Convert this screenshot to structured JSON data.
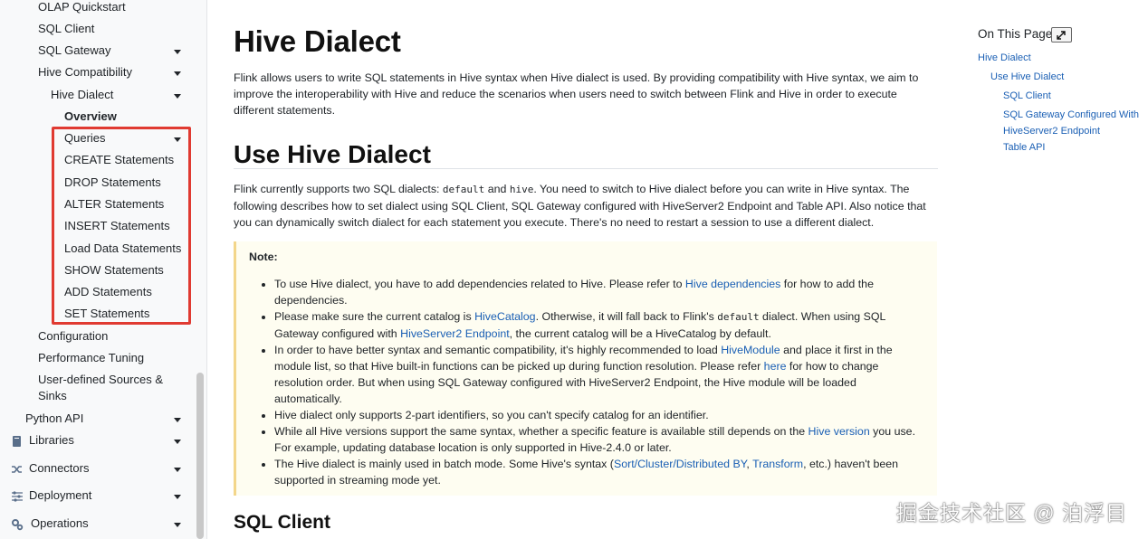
{
  "sidebar": {
    "items": [
      {
        "label": "OLAP Quickstart"
      },
      {
        "label": "SQL Client"
      },
      {
        "label": "SQL Gateway"
      },
      {
        "label": "Hive Compatibility"
      },
      {
        "label": "Hive Dialect"
      },
      {
        "label": "Overview"
      },
      {
        "label": "Queries"
      },
      {
        "label": "CREATE Statements"
      },
      {
        "label": "DROP Statements"
      },
      {
        "label": "ALTER Statements"
      },
      {
        "label": "INSERT Statements"
      },
      {
        "label": "Load Data Statements"
      },
      {
        "label": "SHOW Statements"
      },
      {
        "label": "ADD Statements"
      },
      {
        "label": "SET Statements"
      },
      {
        "label": "Configuration"
      },
      {
        "label": "Performance Tuning"
      },
      {
        "label": "User-defined Sources & Sinks"
      },
      {
        "label": "Python API"
      },
      {
        "label": "Libraries"
      },
      {
        "label": "Connectors"
      },
      {
        "label": "Deployment"
      },
      {
        "label": "Operations"
      }
    ]
  },
  "main": {
    "title": "Hive Dialect",
    "intro": "Flink allows users to write SQL statements in Hive syntax when Hive dialect is used. By providing compatibility with Hive syntax, we aim to improve the interoperability with Hive and reduce the scenarios when users need to switch between Flink and Hive in order to execute different statements.",
    "section_title": "Use Hive Dialect",
    "section_p1": "Flink currently supports two SQL dialects: ",
    "code_default": "default",
    "and": " and ",
    "code_hive": "hive",
    "section_p2": ". You need to switch to Hive dialect before you can write in Hive syntax. The following describes how to set dialect using SQL Client, SQL Gateway configured with HiveServer2 Endpoint and Table API. Also notice that you can dynamically switch dialect for each statement you execute. There's no need to restart a session to use a different dialect.",
    "note": {
      "title": "Note:",
      "b1_a": "To use Hive dialect, you have to add dependencies related to Hive. Please refer to ",
      "b1_link": "Hive dependencies",
      "b1_b": " for how to add the dependencies.",
      "b2_a": "Please make sure the current catalog is ",
      "b2_link1": "HiveCatalog",
      "b2_b": ". Otherwise, it will fall back to Flink's ",
      "b2_code": "default",
      "b2_c": " dialect. When using SQL Gateway configured with ",
      "b2_link2": "HiveServer2 Endpoint",
      "b2_d": ", the current catalog will be a HiveCatalog by default.",
      "b3_a": "In order to have better syntax and semantic compatibility, it's highly recommended to load ",
      "b3_link1": "HiveModule",
      "b3_b": " and place it first in the module list, so that Hive built-in functions can be picked up during function resolution. Please refer ",
      "b3_link2": "here",
      "b3_c": " for how to change resolution order. But when using SQL Gateway configured with HiveServer2 Endpoint, the Hive module will be loaded automatically.",
      "b4": "Hive dialect only supports 2-part identifiers, so you can't specify catalog for an identifier.",
      "b5_a": "While all Hive versions support the same syntax, whether a specific feature is available still depends on the ",
      "b5_link": "Hive version",
      "b5_b": " you use. For example, updating database location is only supported in Hive-2.4.0 or later.",
      "b6_a": "The Hive dialect is mainly used in batch mode. Some Hive's syntax (",
      "b6_link1": "Sort/Cluster/Distributed BY",
      "b6_sep": ", ",
      "b6_link2": "Transform",
      "b6_b": ", etc.) haven't been supported in streaming mode yet."
    },
    "next_heading": "SQL Client"
  },
  "toc": {
    "title": "On This Page",
    "links": [
      {
        "label": "Hive Dialect"
      },
      {
        "label": "Use Hive Dialect"
      },
      {
        "label": "SQL Client"
      },
      {
        "label": "SQL Gateway Configured With HiveServer2 Endpoint"
      },
      {
        "label": "Table API"
      }
    ]
  },
  "watermark": "掘金技术社区 @ 泊浮目",
  "colors": {
    "link": "#1a5fb4",
    "highlight_border": "#e03a31",
    "note_bg": "#fefdf1"
  }
}
